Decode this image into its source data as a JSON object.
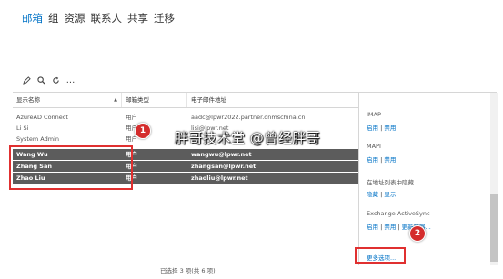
{
  "nav": {
    "tabs": [
      {
        "label": "邮箱",
        "active": true
      },
      {
        "label": "组"
      },
      {
        "label": "资源"
      },
      {
        "label": "联系人"
      },
      {
        "label": "共享"
      },
      {
        "label": "迁移"
      }
    ]
  },
  "toolbar": {
    "icons": [
      "edit-icon",
      "search-icon",
      "refresh-icon",
      "more-icon"
    ],
    "more_label": "..."
  },
  "table": {
    "headers": {
      "name": "显示名称",
      "type": "邮箱类型",
      "email": "电子邮件地址"
    },
    "sort_indicator": "▲",
    "rows": [
      {
        "name": "AzureAD Connect",
        "type": "用户",
        "email": "aadc@lpwr2022.partner.onmschina.cn",
        "selected": false
      },
      {
        "name": "Li Si",
        "type": "用户",
        "email": "lisi@lpwr.net",
        "selected": false
      },
      {
        "name": "System Admin",
        "type": "用户",
        "email": "",
        "selected": false
      },
      {
        "name": "Wang Wu",
        "type": "用户",
        "email": "wangwu@lpwr.net",
        "selected": true
      },
      {
        "name": "Zhang San",
        "type": "用户",
        "email": "zhangsan@lpwr.net",
        "selected": true
      },
      {
        "name": "Zhao Liu",
        "type": "用户",
        "email": "zhaoliu@lpwr.net",
        "selected": true
      }
    ]
  },
  "details": {
    "imap": {
      "title": "IMAP",
      "enable": "启用",
      "sep": " | ",
      "disable": "禁用"
    },
    "mapi": {
      "title": "MAPI",
      "enable": "启用",
      "sep": " | ",
      "disable": "禁用"
    },
    "address_list": {
      "title": "在地址列表中隐藏",
      "hide": "隐藏",
      "sep": " | ",
      "show": "显示"
    },
    "activesync": {
      "title": "Exchange ActiveSync",
      "enable": "启用",
      "sep": " | ",
      "disable": "禁用",
      "sep2": " | ",
      "more": "更新策略..."
    },
    "more_options": "更多选项..."
  },
  "status": {
    "text": "已选择 3 项(共 6 项)"
  },
  "annotations": {
    "badge1": "1",
    "badge2": "2",
    "watermark": "胖哥技术堂 @曾经胖哥",
    "accent": "#e03030"
  },
  "colors": {
    "accent": "#0072c6",
    "selected_row": "#5c5c5c",
    "highlight": "#e03030"
  }
}
